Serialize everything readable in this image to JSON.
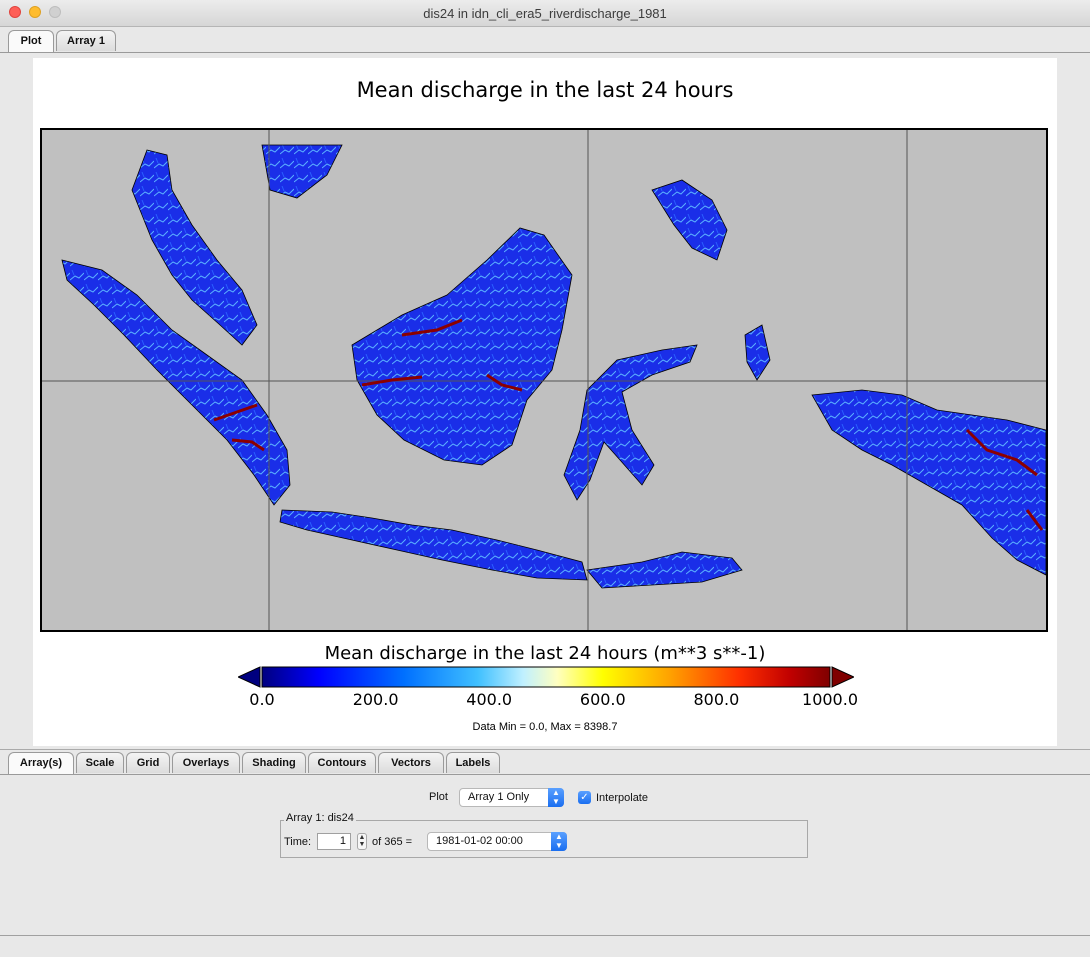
{
  "window": {
    "title": "dis24 in idn_cli_era5_riverdischarge_1981"
  },
  "top_tabs": [
    {
      "label": "Plot",
      "active": true
    },
    {
      "label": "Array 1",
      "active": false
    }
  ],
  "plot": {
    "title": "Mean discharge in the last 24 hours",
    "colorbar_title": "Mean discharge in the last 24 hours (m**3 s**-1)",
    "colorbar_ticks": [
      "0.0",
      "200.0",
      "400.0",
      "600.0",
      "800.0",
      "1000.0"
    ],
    "colorbar_range": [
      0,
      1000
    ],
    "colorbar_colors": [
      "#00007f",
      "#0000ff",
      "#0070ff",
      "#40c0ff",
      "#c0f0ff",
      "#ffffc0",
      "#ffff00",
      "#ffa000",
      "#ff3000",
      "#c00000",
      "#7f0000"
    ],
    "data_range_text": "Data Min = 0.0, Max = 8398.7",
    "map_background": "#c0c0c0",
    "land_color": "#1a2ee8"
  },
  "bottom_tabs": [
    {
      "label": "Array(s)",
      "active": true
    },
    {
      "label": "Scale",
      "active": false
    },
    {
      "label": "Grid",
      "active": false
    },
    {
      "label": "Overlays",
      "active": false
    },
    {
      "label": "Shading",
      "active": false
    },
    {
      "label": "Contours",
      "active": false
    },
    {
      "label": "Vectors",
      "active": false
    },
    {
      "label": "Labels",
      "active": false
    }
  ],
  "controls": {
    "plot_label": "Plot",
    "plot_select_value": "Array 1 Only",
    "interpolate_label": "Interpolate",
    "interpolate_checked": true,
    "array_group_label": "Array 1: dis24",
    "time_label": "Time:",
    "time_value": "1",
    "of_text": "of 365 =",
    "time_select_value": "1981-01-02 00:00"
  }
}
